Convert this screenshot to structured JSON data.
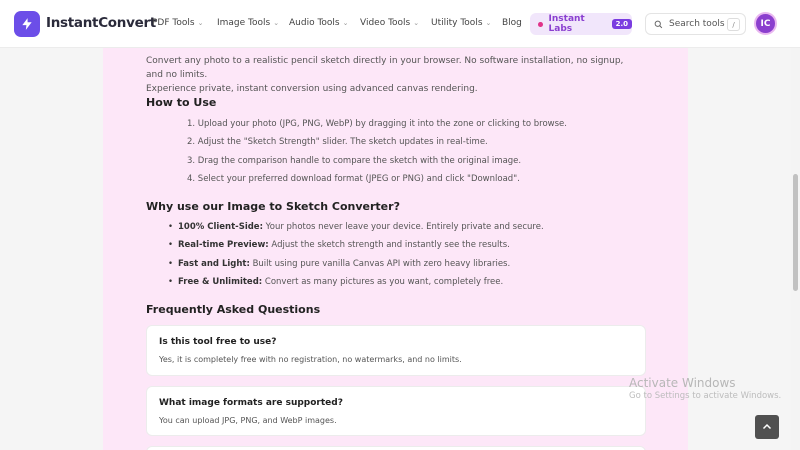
{
  "header": {
    "logo_text": "InstantConvert",
    "nav": [
      {
        "label": "PDF Tools",
        "chevron": "⌄"
      },
      {
        "label": "Image Tools",
        "chevron": "⌄"
      },
      {
        "label": "Audio Tools",
        "chevron": "⌄"
      },
      {
        "label": "Video Tools",
        "chevron": "⌄"
      },
      {
        "label": "Utility Tools",
        "chevron": "⌄"
      },
      {
        "label": "Blog",
        "chevron": ""
      }
    ],
    "labs_label": "Instant Labs",
    "labs_badge": "2.0",
    "search_placeholder": "Search tools",
    "search_shortcut": "/",
    "avatar_initials": "IC"
  },
  "content": {
    "intro_line1": "Convert any photo to a realistic pencil sketch directly in your browser. No software installation, no signup, and no limits.",
    "intro_line2": "Experience private, instant conversion using advanced canvas rendering.",
    "how_title": "How to Use",
    "steps": [
      "1. Upload your photo (JPG, PNG, WebP) by dragging it into the zone or clicking to browse.",
      "2. Adjust the \"Sketch Strength\" slider. The sketch updates in real-time.",
      "3. Drag the comparison handle to compare the sketch with the original image.",
      "4. Select your preferred download format (JPEG or PNG) and click \"Download\"."
    ],
    "why_title": "Why use our Image to Sketch Converter?",
    "features": [
      {
        "bold": "100% Client-Side:",
        "text": " Your photos never leave your device. Entirely private and secure."
      },
      {
        "bold": "Real-time Preview:",
        "text": " Adjust the sketch strength and instantly see the results."
      },
      {
        "bold": "Fast and Light:",
        "text": " Built using pure vanilla Canvas API with zero heavy libraries."
      },
      {
        "bold": "Free & Unlimited:",
        "text": " Convert as many pictures as you want, completely free."
      }
    ],
    "faq_title": "Frequently Asked Questions",
    "faqs": [
      {
        "q": "Is this tool free to use?",
        "a": "Yes, it is completely free with no registration, no watermarks, and no limits."
      },
      {
        "q": "What image formats are supported?",
        "a": "You can upload JPG, PNG, and WebP images."
      }
    ]
  },
  "watermark": {
    "line1": "Activate Windows",
    "line2": "Go to Settings to activate Windows."
  },
  "colors": {
    "brand": "#6c4ee8",
    "panel_bg": "#fde7f8",
    "labs_bg": "#f1e6fb",
    "labs_text": "#8a3fd0"
  }
}
